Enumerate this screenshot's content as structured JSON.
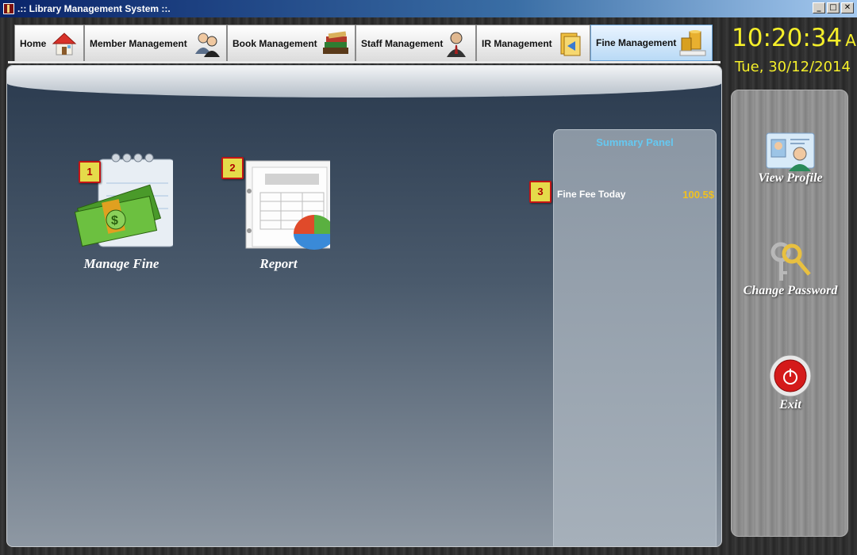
{
  "window": {
    "title": ".:: Library Management System ::.",
    "buttons": {
      "minimize": "_",
      "maximize": "□",
      "close": "✕"
    }
  },
  "tabs": [
    {
      "label": "Home",
      "icon": "house-icon"
    },
    {
      "label": "Member Management",
      "icon": "users-icon"
    },
    {
      "label": "Book Management",
      "icon": "books-icon"
    },
    {
      "label": "Staff Management",
      "icon": "staff-icon"
    },
    {
      "label": "IR Management",
      "icon": "issue-return-icon"
    },
    {
      "label": "Fine Management",
      "icon": "coins-icon",
      "active": true
    }
  ],
  "clock": {
    "time": "10:20:34",
    "ampm": "AM",
    "date": "Tue, 30/12/2014"
  },
  "modules": [
    {
      "badge": "1",
      "label": "Manage Fine",
      "icon": "money-notepad-icon"
    },
    {
      "badge": "2",
      "label": "Report",
      "icon": "report-chart-icon"
    }
  ],
  "summary": {
    "title": "Summary Panel",
    "badge": "3",
    "fine_label": "Fine Fee Today",
    "fine_value": "100.5$"
  },
  "side": {
    "view_profile": "View Profile",
    "change_password": "Change Password",
    "exit": "Exit"
  },
  "colors": {
    "clock": "#f4ee2a",
    "summary_title": "#66c8f0",
    "fine_value": "#f0c020",
    "badge_bg": "#e5db4a",
    "badge_border": "#c21515"
  }
}
